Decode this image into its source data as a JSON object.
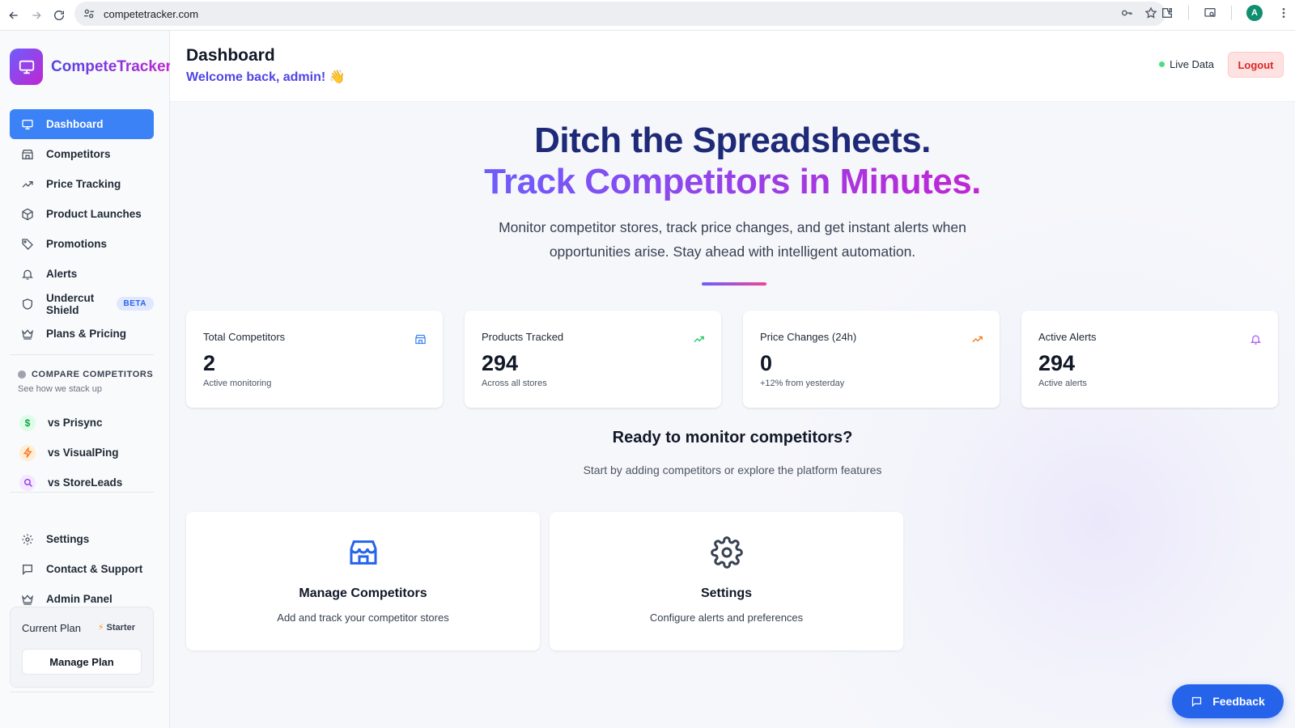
{
  "browser": {
    "url": "competetracker.com",
    "avatar_letter": "A"
  },
  "sidebar": {
    "brand": "CompeteTracker",
    "items": [
      {
        "label": "Dashboard",
        "icon": "monitor-icon",
        "active": true
      },
      {
        "label": "Competitors",
        "icon": "store-icon"
      },
      {
        "label": "Price Tracking",
        "icon": "trending-up-icon"
      },
      {
        "label": "Product Launches",
        "icon": "package-icon"
      },
      {
        "label": "Promotions",
        "icon": "tag-icon"
      },
      {
        "label": "Alerts",
        "icon": "bell-icon"
      },
      {
        "label": "Undercut Shield",
        "icon": "shield-icon",
        "badge": "BETA"
      },
      {
        "label": "Plans & Pricing",
        "icon": "crown-icon"
      }
    ],
    "compare": {
      "heading": "COMPARE COMPETITORS",
      "subtitle": "See how we stack up",
      "items": [
        {
          "label": "vs Prisync",
          "icon": "dollar-icon",
          "color": "#16a34a",
          "bg": "#dcfce7"
        },
        {
          "label": "vs VisualPing",
          "icon": "bolt-icon",
          "color": "#f97316",
          "bg": "#ffedd5"
        },
        {
          "label": "vs StoreLeads",
          "icon": "search-icon",
          "color": "#9333ea",
          "bg": "#f3e8ff"
        }
      ]
    },
    "bottom_items": [
      {
        "label": "Settings",
        "icon": "gear-icon"
      },
      {
        "label": "Contact & Support",
        "icon": "message-icon"
      },
      {
        "label": "Admin Panel",
        "icon": "crown-icon"
      }
    ],
    "plan": {
      "label": "Current Plan",
      "badge": "Starter",
      "button": "Manage Plan"
    }
  },
  "header": {
    "title": "Dashboard",
    "welcome": "Welcome back, admin! 👋",
    "live": "Live Data",
    "logout": "Logout"
  },
  "hero": {
    "line1": "Ditch the Spreadsheets.",
    "line2": "Track Competitors in Minutes.",
    "subtitle": "Monitor competitor stores, track price changes, and get instant alerts when opportunities arise. Stay ahead with intelligent automation."
  },
  "stats": [
    {
      "label": "Total Competitors",
      "value": "2",
      "note": "Active monitoring",
      "icon": "store-icon",
      "color": "#3b82f6"
    },
    {
      "label": "Products Tracked",
      "value": "294",
      "note": "Across all stores",
      "icon": "trending-up-icon",
      "color": "#22c55e"
    },
    {
      "label": "Price Changes (24h)",
      "value": "0",
      "note": "+12% from yesterday",
      "icon": "trending-up-icon",
      "color": "#f97316"
    },
    {
      "label": "Active Alerts",
      "value": "294",
      "note": "Active alerts",
      "icon": "bell-icon",
      "color": "#a855f7"
    }
  ],
  "ready": {
    "title": "Ready to monitor competitors?",
    "subtitle": "Start by adding competitors or explore the platform features"
  },
  "cards": [
    {
      "title": "Manage Competitors",
      "subtitle": "Add and track your competitor stores",
      "icon": "store-icon",
      "color": "#2563eb"
    },
    {
      "title": "Settings",
      "subtitle": "Configure alerts and preferences",
      "icon": "gear-icon",
      "color": "#374151"
    }
  ],
  "feedback": "Feedback"
}
